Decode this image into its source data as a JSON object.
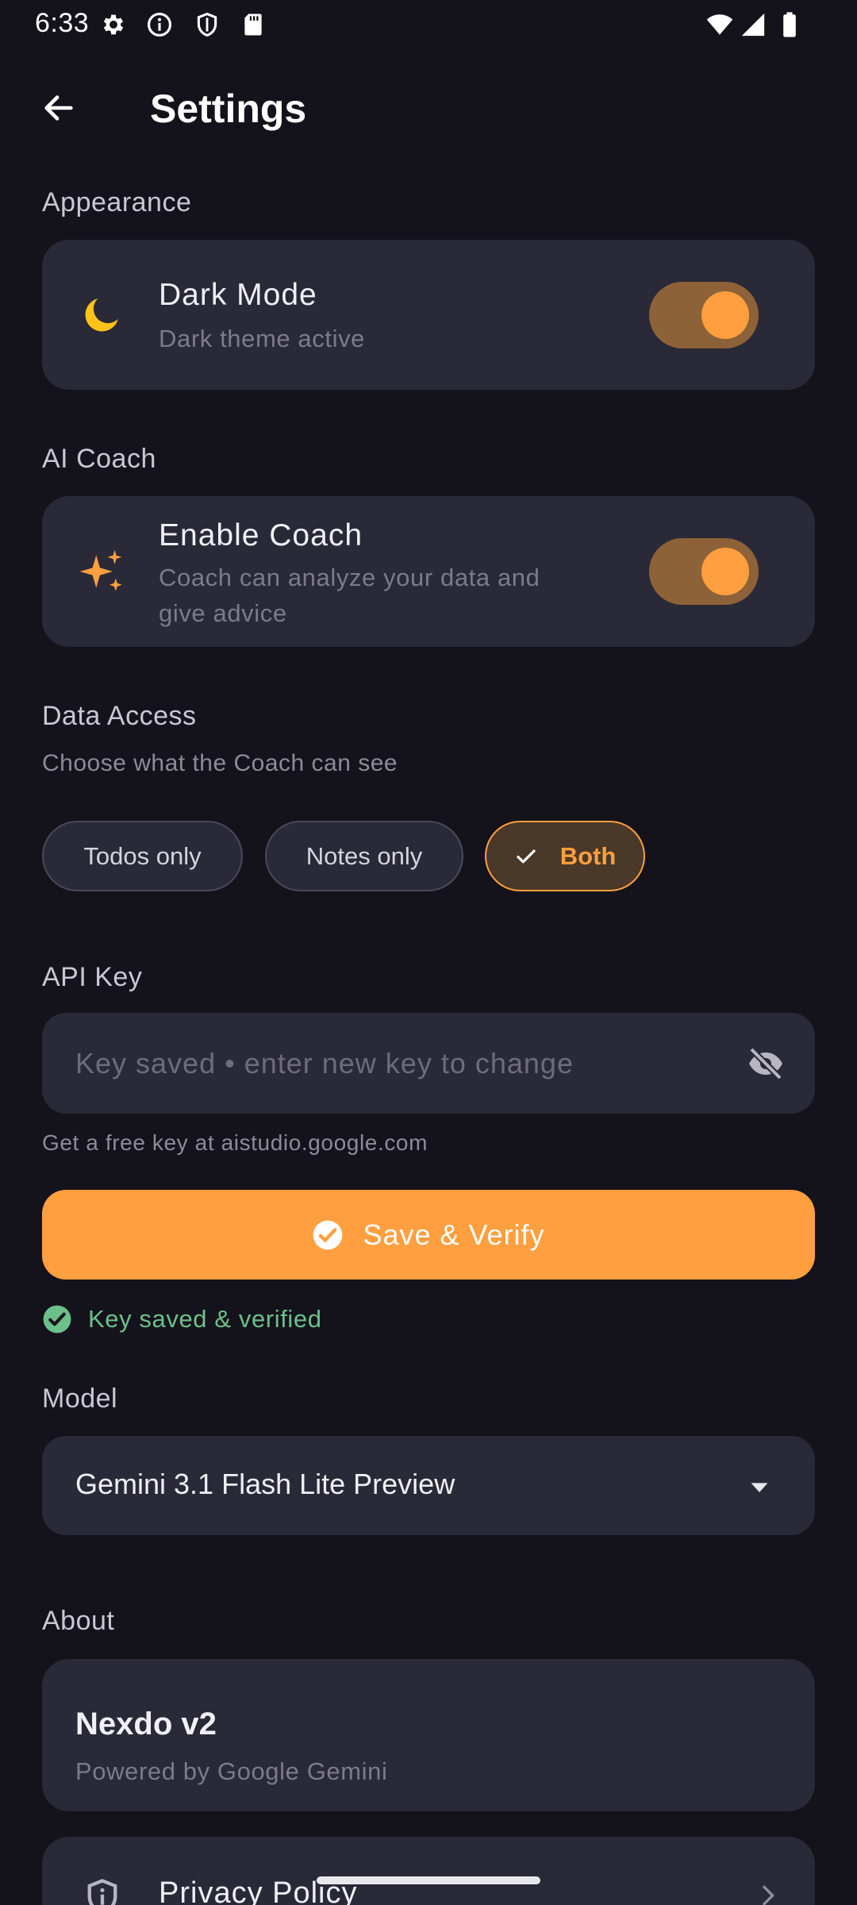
{
  "status_bar": {
    "time": "6:33",
    "icons": [
      "gear-icon",
      "info-icon",
      "shield-icon",
      "sd-card-icon",
      "wifi-icon",
      "signal-icon",
      "battery-icon"
    ]
  },
  "app_bar": {
    "title": "Settings",
    "back_icon": "arrow-back-icon"
  },
  "appearance": {
    "section_title": "Appearance",
    "dark_mode": {
      "title": "Dark Mode",
      "subtitle": "Dark theme active",
      "icon": "moon-icon",
      "enabled": true
    }
  },
  "ai_coach": {
    "section_title": "AI Coach",
    "enable_coach": {
      "title": "Enable Coach",
      "subtitle_line1": "Coach can analyze your data and",
      "subtitle_line2": "give advice",
      "icon": "sparkles-icon",
      "enabled": true
    }
  },
  "data_access": {
    "section_title": "Data Access",
    "subtitle": "Choose what the Coach can see",
    "options": [
      {
        "label": "Todos only",
        "selected": false
      },
      {
        "label": "Notes only",
        "selected": false
      },
      {
        "label": "Both",
        "selected": true
      }
    ]
  },
  "api_key": {
    "section_title": "API Key",
    "placeholder": "Key saved • enter new key to change",
    "value": "",
    "visibility_icon": "eye-off-icon",
    "helper": "Get a free key at aistudio.google.com",
    "save_label": "Save & Verify",
    "status": "Key saved & verified"
  },
  "model": {
    "section_title": "Model",
    "selected": "Gemini 3.1 Flash Lite Preview"
  },
  "about": {
    "section_title": "About",
    "app_name": "Nexdo v2",
    "powered_by": "Powered by Google Gemini",
    "privacy_label": "Privacy Policy"
  },
  "colors": {
    "background": "#14131b",
    "card": "#2a2937",
    "accent": "#ff9f3f",
    "toggle_track": "#8d6238",
    "moon": "#ffc21a",
    "success": "#6cc08a"
  }
}
